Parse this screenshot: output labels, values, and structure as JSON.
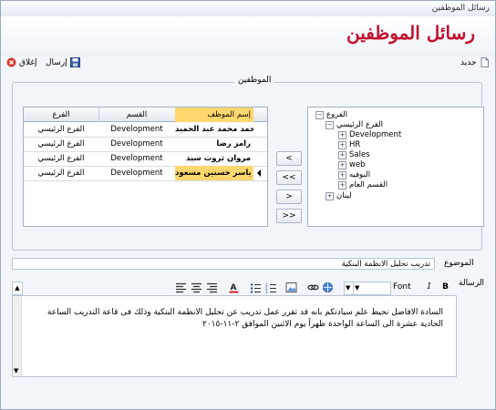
{
  "window": {
    "title": "رسائل الموظفين"
  },
  "header": {
    "title": "رسائل الموظفين"
  },
  "toolbar": {
    "new": "جديد",
    "send": "إرسال",
    "close": "إغلاق"
  },
  "employees": {
    "legend": "الموظفين",
    "columns": [
      "إسم الموظف",
      "القسم",
      "الفرع"
    ],
    "rows": [
      {
        "name": "أحمد محمد عبد الحميد",
        "dept": "Development",
        "branch": "الفرع الرئيسي"
      },
      {
        "name": "رامز رضا",
        "dept": "Development",
        "branch": "الفرع الرئيسي"
      },
      {
        "name": "مروان ثروت سيد",
        "dept": "Development",
        "branch": "الفرع الرئيسي"
      },
      {
        "name": "ياسر حسنين مسعود",
        "dept": "Development",
        "branch": "الفرع الرئيسي"
      }
    ]
  },
  "tree": {
    "root": "الفروع",
    "main_branch": "الفرع الرئيسي",
    "items": [
      "Development",
      "HR",
      "Sales",
      "web",
      "البوفيه",
      "القسم العام"
    ],
    "other": "لبنان"
  },
  "transfer": {
    "add": "<",
    "add_all": "<<",
    "remove": ">",
    "remove_all": ">>"
  },
  "subject": {
    "label": "الموضوع",
    "value": "تدريب تحليل الانظمة البنكية"
  },
  "message": {
    "label": "الرسالة",
    "font_label": "Font",
    "body": "السادة الافاضل نحيط علم سيادتكم بانه قد تقرر عمل تدريب عن تحليل الانظمة البنكية وذلك فى قاعة التدريب الساعة الحادية عشرة الى الساعة الواحدة ظهراً يوم الاثنين الموافق ٢-١١-٢٠١٥"
  },
  "colors": {
    "accent": "#c1122f",
    "selected": "#ffd76e"
  }
}
